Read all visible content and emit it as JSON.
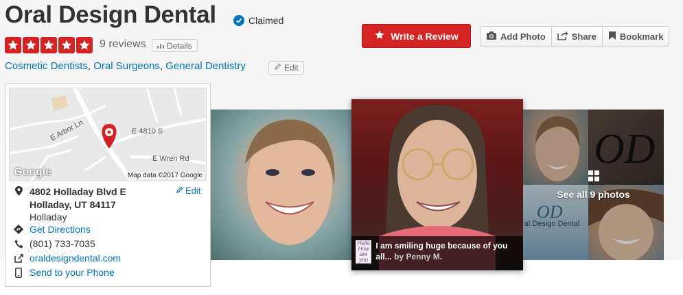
{
  "business": {
    "name": "Oral Design Dental",
    "claimed_label": "Claimed",
    "review_count": "9 reviews",
    "details_label": "Details",
    "rating": 5,
    "categories": [
      "Cosmetic Dentists",
      "Oral Surgeons",
      "General Dentistry"
    ],
    "category_sep": ", ",
    "edit_label": "Edit"
  },
  "actions": {
    "write_review": "Write a Review",
    "add_photo": "Add Photo",
    "share": "Share",
    "bookmark": "Bookmark"
  },
  "map": {
    "streets": [
      "E Arbor Ln",
      "E 4810 S",
      "E Wren Rd"
    ],
    "google_label": "Google",
    "credit": "Map data ©2017 Google"
  },
  "info": {
    "address_line1": "4802 Holladay Blvd E",
    "address_line2": "Holladay, UT 84117",
    "neighborhood": "Holladay",
    "edit_label": "Edit",
    "directions": "Get Directions",
    "phone": "(801) 733-7035",
    "website": "oraldesigndental.com",
    "send_phone": "Send to your Phone"
  },
  "photos": {
    "caption_text": "I am smiling huge because of you all...",
    "caption_by": "by Penny M.",
    "thumb_text": "Hello How are you",
    "see_all": "See all 9 photos",
    "logo_text": "OD",
    "logo_sub": "ral Design Dental"
  },
  "colors": {
    "brand_red": "#d32323",
    "link_blue": "#0073bb"
  }
}
